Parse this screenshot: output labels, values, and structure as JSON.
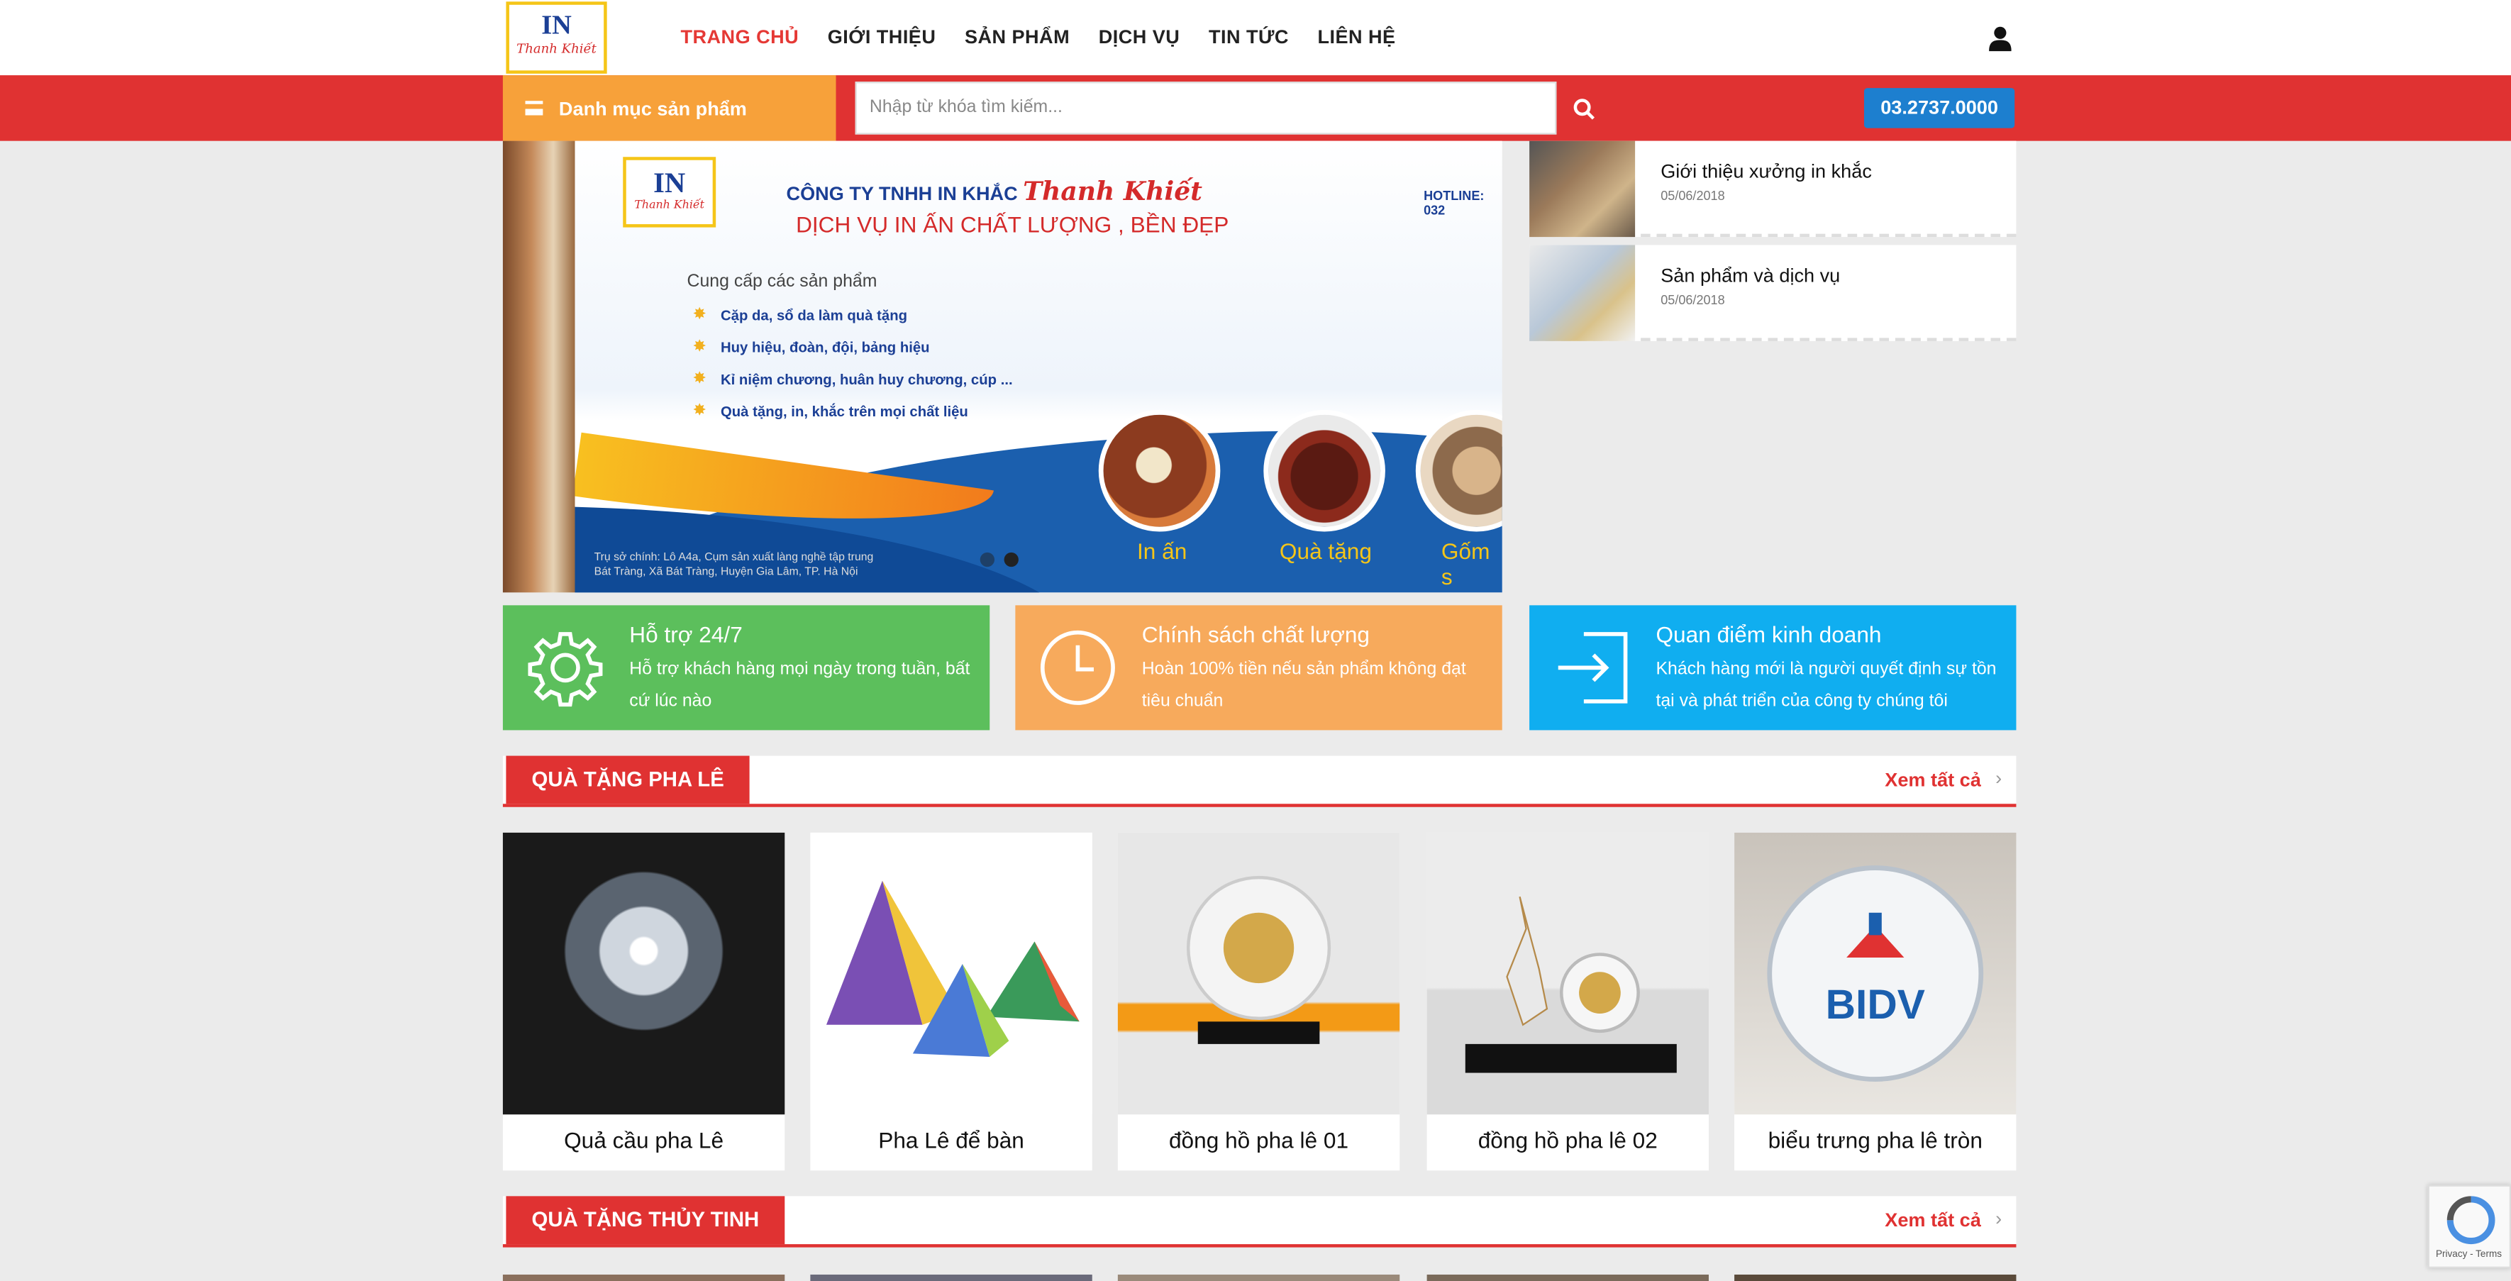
{
  "brand": {
    "logo_in": "IN",
    "logo_name": "Thanh Khiết"
  },
  "nav": [
    {
      "label": "TRANG CHỦ"
    },
    {
      "label": "GIỚI THIỆU"
    },
    {
      "label": "SẢN PHẨM"
    },
    {
      "label": "DỊCH VỤ"
    },
    {
      "label": "TIN TỨC"
    },
    {
      "label": "LIÊN HỆ"
    }
  ],
  "header": {
    "category_button": "Danh mục sản phẩm",
    "search_placeholder": "Nhập từ khóa tìm kiếm...",
    "hotline": "03.2737.0000",
    "accent_color": "#e03232"
  },
  "banner": {
    "company": "CÔNG TY TNHH IN KHẮC",
    "brand": "Thanh Khiết",
    "slogan": "DỊCH VỤ IN ẤN CHẤT LƯỢNG , BỀN ĐẸP",
    "hotline": "HOTLINE: 032",
    "provide_title": "Cung cấp các sản phẩm",
    "items": [
      "Cặp da, sổ da làm quà tặng",
      "Huy hiệu, đoàn, đội, bảng hiệu",
      "Kỉ niệm chương, huân huy chương, cúp ...",
      "Quà tặng, in, khắc trên mọi chất liệu"
    ],
    "circles": [
      "In ấn",
      "Quà tặng",
      "Gốm s"
    ],
    "address_1": "Trụ sở chính: Lô A4a, Cụm sản xuất làng nghề tập trung",
    "address_2": "Bát Tràng, Xã Bát Tràng, Huyện Gia Lâm, TP. Hà Nội"
  },
  "news": [
    {
      "title": "Giới thiệu xưởng in khắc",
      "date": "05/06/2018"
    },
    {
      "title": "Sản phẩm và dịch vụ",
      "date": "05/06/2018"
    }
  ],
  "features": [
    {
      "title": "Hỗ trợ 24/7",
      "desc": "Hỗ trợ khách hàng mọi ngày trong tuần, bất cứ lúc nào",
      "color": "#5cbf5c",
      "icon": "gear-icon"
    },
    {
      "title": "Chính sách chất lượng",
      "desc": "Hoàn 100% tiền nếu sản phẩm không đạt tiêu chuẩn",
      "color": "#f7aa5c",
      "icon": "clock-icon"
    },
    {
      "title": "Quan điểm kinh doanh",
      "desc": "Khách hàng mới là người quyết định sự tồn tại và phát triển của công ty chúng tôi",
      "color": "#10aef0",
      "icon": "sign-in-icon"
    }
  ],
  "sections": [
    {
      "title": "QUÀ TẶNG PHA LÊ",
      "more": "Xem tất cả",
      "products": [
        {
          "name": "Quả cầu pha Lê"
        },
        {
          "name": "Pha Lê để bàn"
        },
        {
          "name": "đồng hồ pha lê 01"
        },
        {
          "name": "đồng hồ pha lê 02"
        },
        {
          "name": "biểu trưng pha lê tròn"
        }
      ]
    },
    {
      "title": "QUÀ TẶNG THỦY TINH",
      "more": "Xem tất cả"
    }
  ],
  "recaptcha": {
    "label": "Privacy - Terms"
  },
  "bidv_text": "BIDV"
}
